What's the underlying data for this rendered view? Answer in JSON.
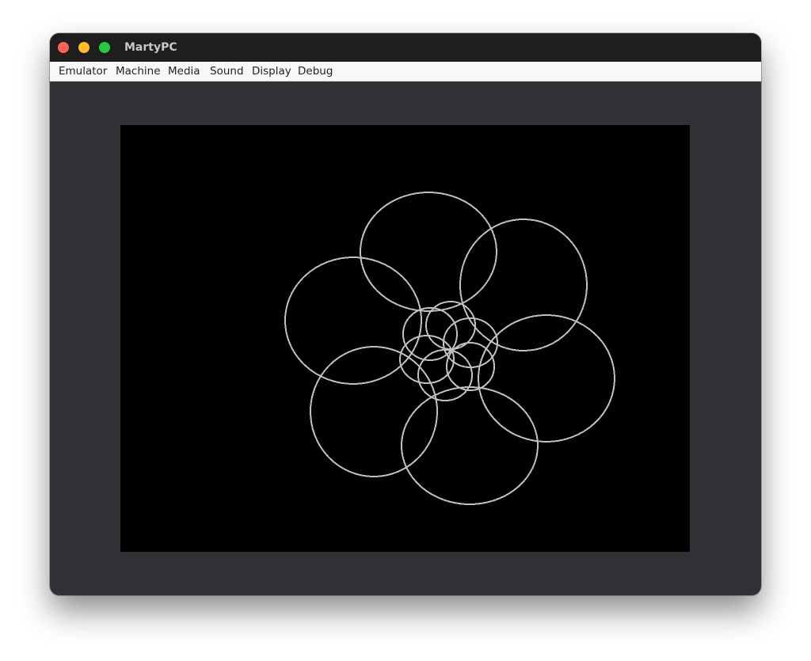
{
  "window": {
    "title": "MartyPC"
  },
  "menubar": {
    "items": [
      {
        "label": "Emulator"
      },
      {
        "label": "Machine"
      },
      {
        "label": "Media"
      },
      {
        "label": "Sound"
      },
      {
        "label": "Display"
      },
      {
        "label": "Debug"
      }
    ]
  },
  "display": {
    "background_color": "#000000",
    "stroke_color": "#c0c0c0"
  },
  "colors": {
    "titlebar": "#1e1e1e",
    "window_body": "#303035",
    "menubar": "#f8f8f8",
    "close": "#fe5f57",
    "minimize": "#febc2e",
    "zoom": "#28c840"
  }
}
